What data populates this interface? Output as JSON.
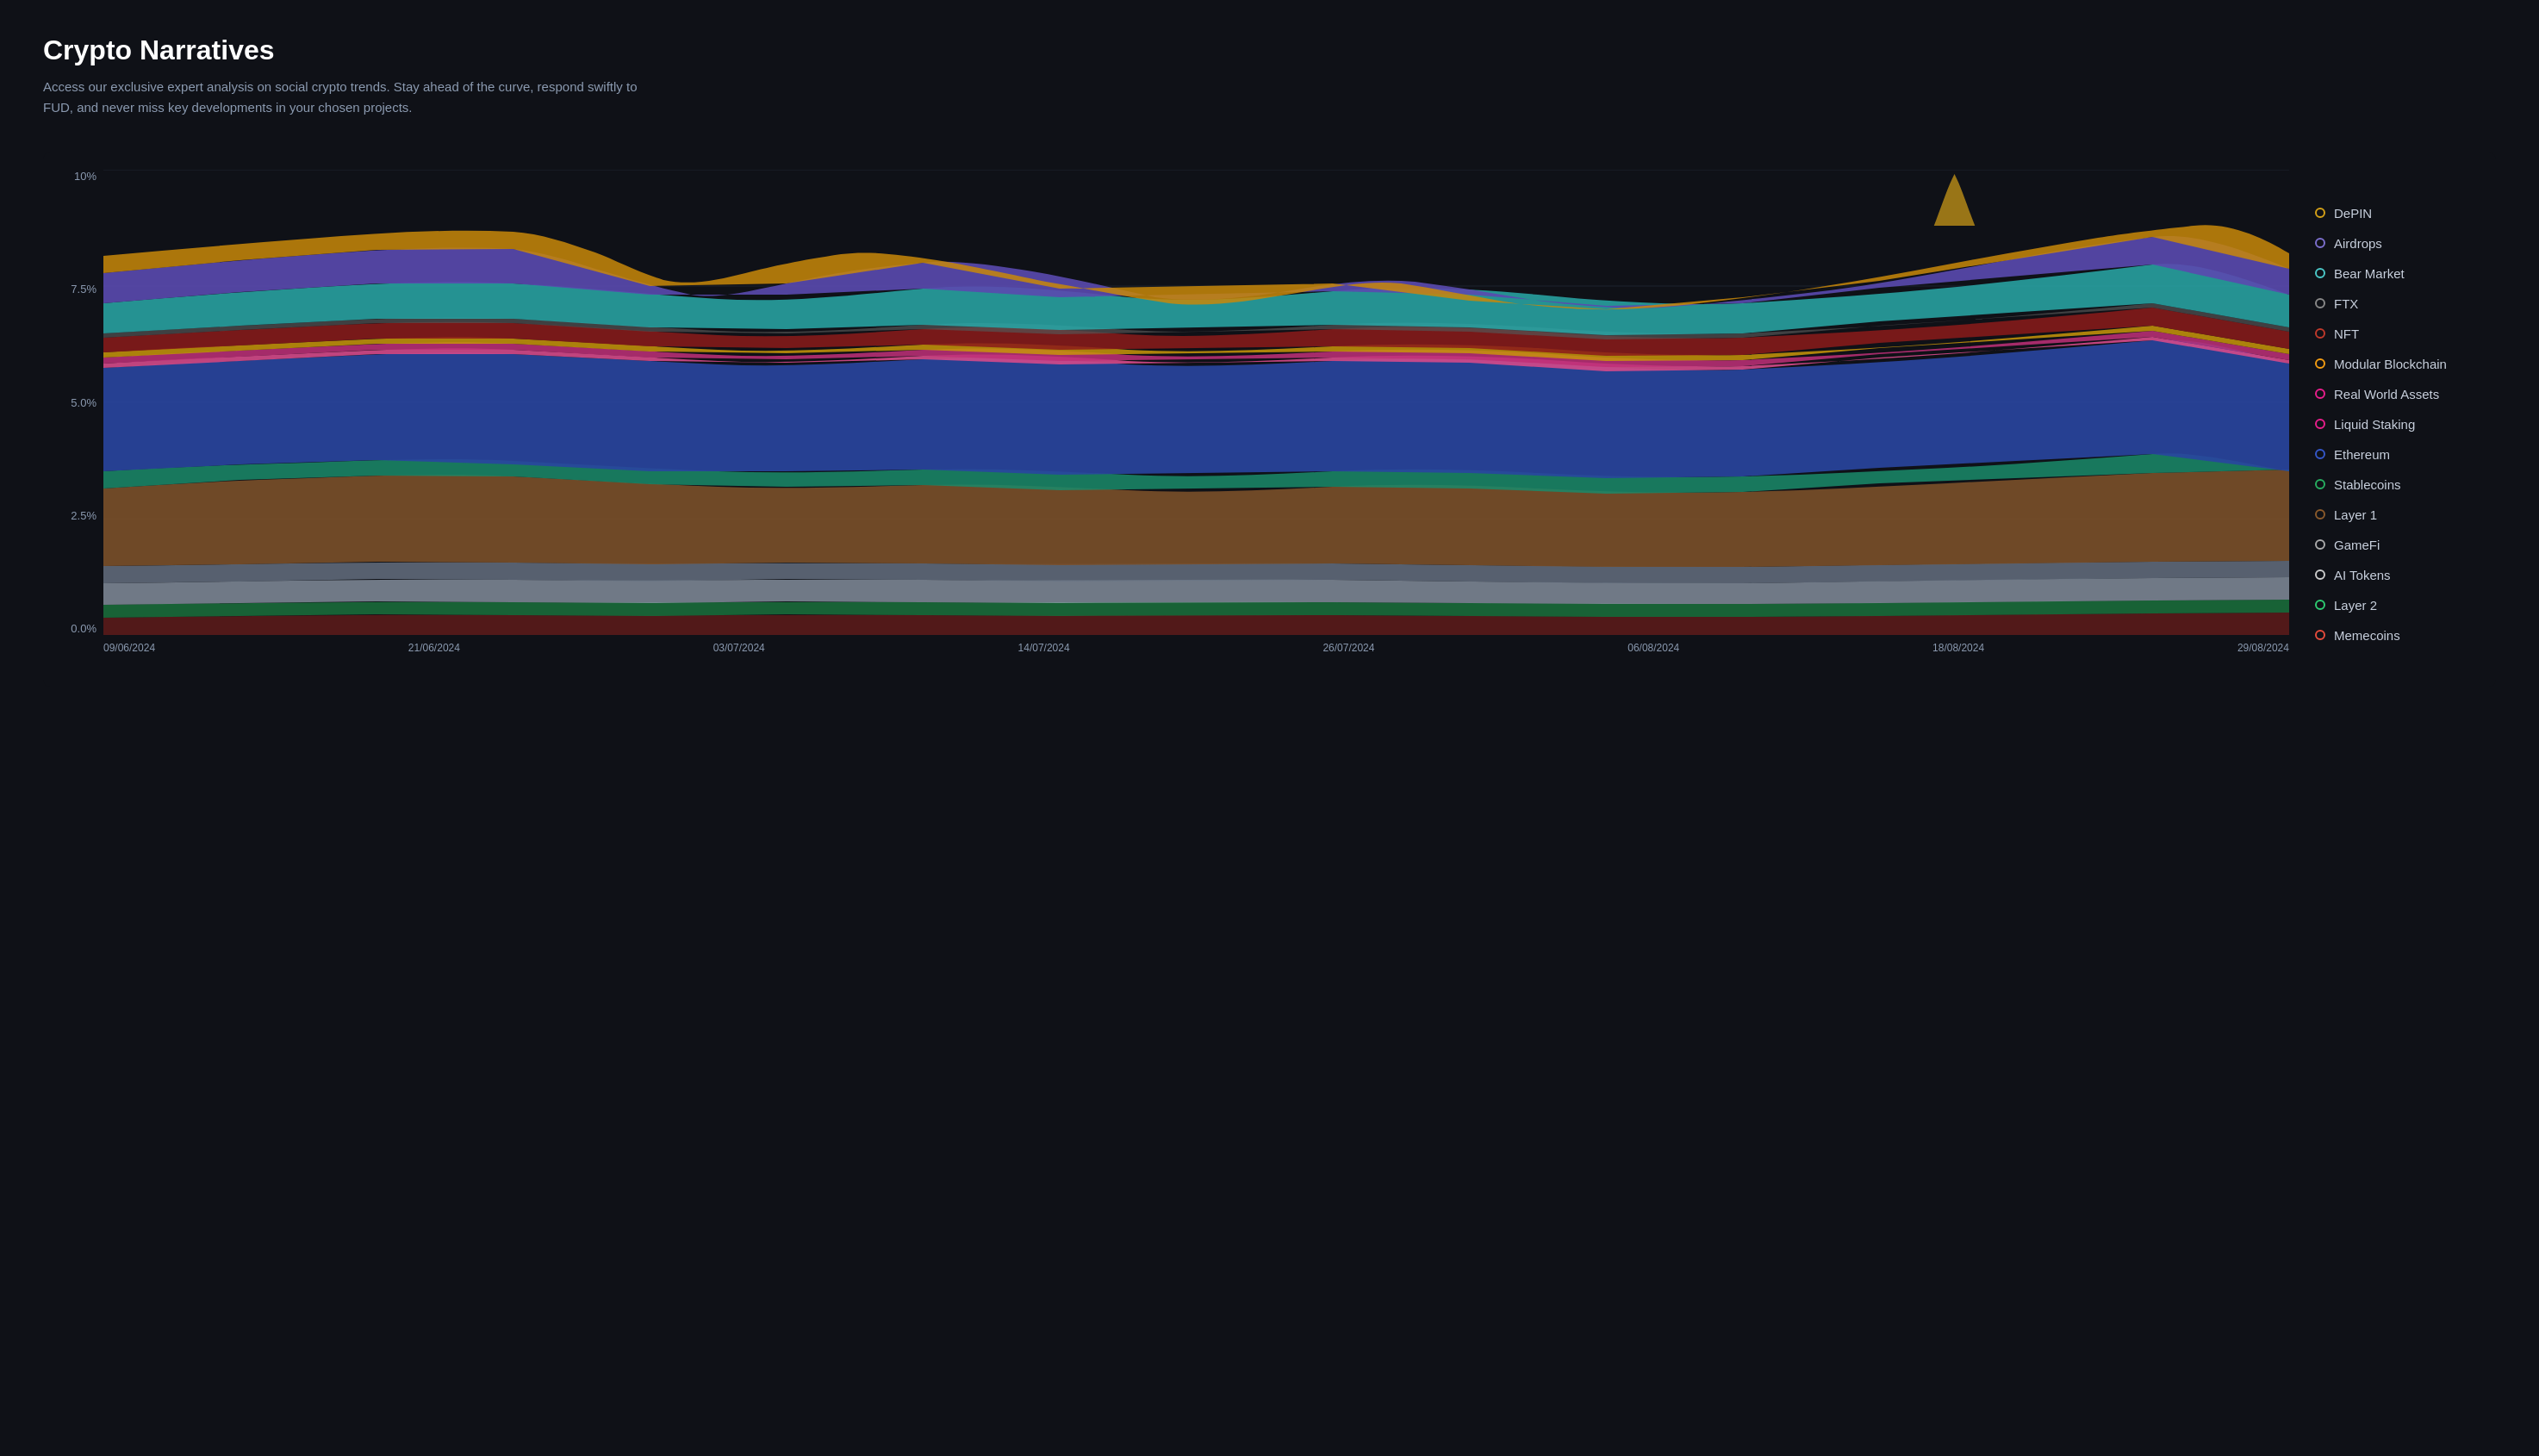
{
  "page": {
    "title": "Crypto Narratives",
    "description": "Access our exclusive expert analysis on social crypto trends. Stay ahead of the curve, respond swiftly to FUD, and never miss key developments in your chosen projects."
  },
  "chart": {
    "y_labels": [
      "10%",
      "7.5%",
      "5.0%",
      "2.5%",
      "0.0%"
    ],
    "x_labels": [
      "09/06/2024",
      "21/06/2024",
      "03/07/2024",
      "14/07/2024",
      "26/07/2024",
      "06/08/2024",
      "18/08/2024",
      "29/08/2024"
    ]
  },
  "legend": {
    "items": [
      {
        "label": "DePIN",
        "color": "#d4a017"
      },
      {
        "label": "Airdrops",
        "color": "#7c6fcd"
      },
      {
        "label": "Bear Market",
        "color": "#4bc8c8"
      },
      {
        "label": "FTX",
        "color": "#888888"
      },
      {
        "label": "NFT",
        "color": "#c0392b"
      },
      {
        "label": "Modular Blockchain",
        "color": "#f39c12"
      },
      {
        "label": "Real World Assets",
        "color": "#e91e8c"
      },
      {
        "label": "Liquid Staking",
        "color": "#e91e8c"
      },
      {
        "label": "Ethereum",
        "color": "#3457c9"
      },
      {
        "label": "Stablecoins",
        "color": "#27ae60"
      },
      {
        "label": "Layer 1",
        "color": "#8b5a2b"
      },
      {
        "label": "GameFi",
        "color": "#aaaaaa"
      },
      {
        "label": "AI Tokens",
        "color": "#cccccc"
      },
      {
        "label": "Layer 2",
        "color": "#2ecc71"
      },
      {
        "label": "Memecoins",
        "color": "#e74c3c"
      }
    ]
  }
}
